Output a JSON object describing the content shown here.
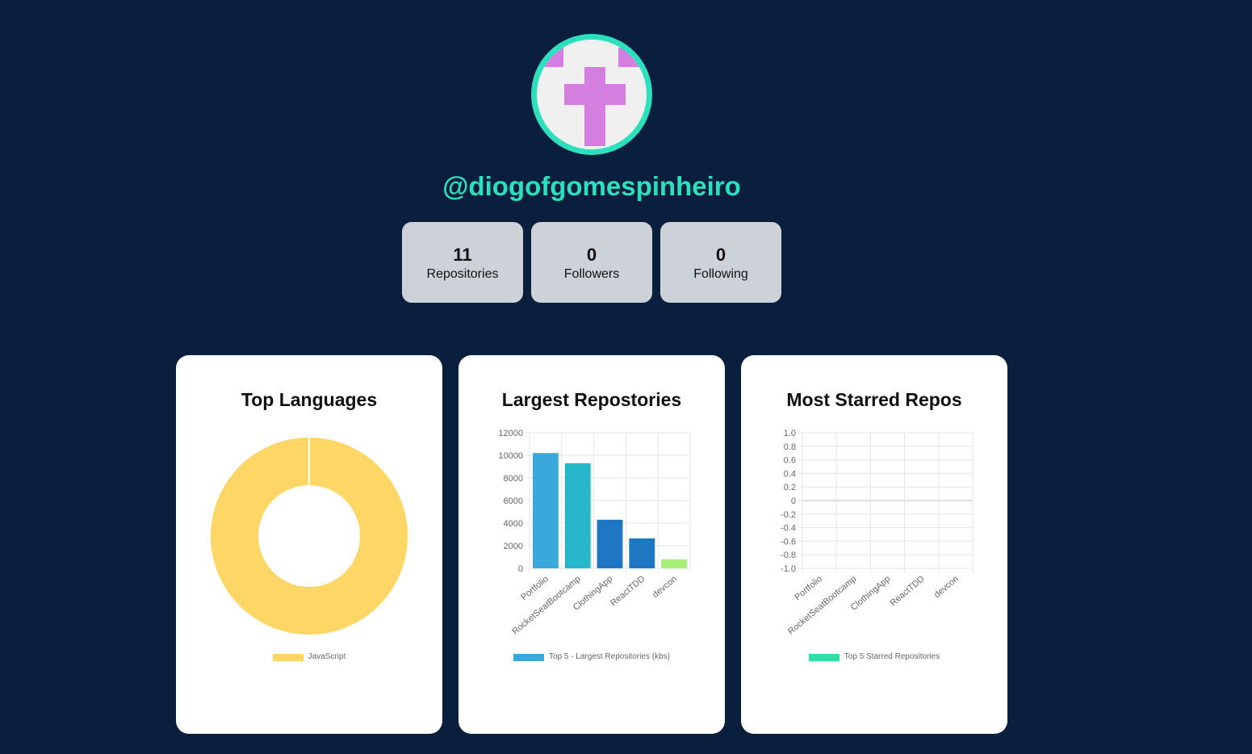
{
  "profile": {
    "username": "@diogofgomespinheiro",
    "avatar_colors": {
      "ring": "#2de0bd",
      "bg": "#f0f0f0",
      "cross": "#d47fe0"
    }
  },
  "stats": [
    {
      "value": "11",
      "label": "Repositories"
    },
    {
      "value": "0",
      "label": "Followers"
    },
    {
      "value": "0",
      "label": "Following"
    }
  ],
  "cards": {
    "languages": {
      "title": "Top Languages"
    },
    "largest": {
      "title": "Largest Repostories"
    },
    "starred": {
      "title": "Most Starred Repos"
    }
  },
  "chart_data": [
    {
      "type": "pie",
      "title": "Top Languages",
      "variant": "doughnut",
      "labels": [
        "JavaScript"
      ],
      "values": [
        100
      ],
      "colors": [
        "#fed666"
      ],
      "legend": "bottom"
    },
    {
      "type": "bar",
      "title": "Largest Repostories",
      "categories": [
        "Portfolio",
        "RocketSeatBootcamp",
        "ClothingApp",
        "ReactTDD",
        "devcon"
      ],
      "series": [
        {
          "name": "Top 5 - Largest Repositories (kbs)",
          "values": [
            10200,
            9300,
            4300,
            2650,
            800
          ]
        }
      ],
      "colors": [
        "#3aa8db",
        "#28b6ca",
        "#1f77c4",
        "#1f77c4",
        "#a8f07a"
      ],
      "ylim": [
        0,
        12000
      ],
      "yticks": [
        "12000",
        "10000",
        "8000",
        "6000",
        "4000",
        "2000",
        "0"
      ],
      "grid": true,
      "legend": "bottom"
    },
    {
      "type": "bar",
      "title": "Most Starred Repos",
      "categories": [
        "Portfolio",
        "RocketSeatBootcamp",
        "ClothingApp",
        "ReactTDD",
        "devcon"
      ],
      "series": [
        {
          "name": "Top 5 Starred Repositories",
          "values": [
            0,
            0,
            0,
            0,
            0
          ]
        }
      ],
      "colors": [
        "#2de0a5"
      ],
      "ylim": [
        -1.0,
        1.0
      ],
      "yticks": [
        "1.0",
        "0.8",
        "0.6",
        "0.4",
        "0.2",
        "0",
        "-0.2",
        "-0.4",
        "-0.6",
        "-0.8",
        "-1.0"
      ],
      "grid": true,
      "legend": "bottom"
    }
  ]
}
